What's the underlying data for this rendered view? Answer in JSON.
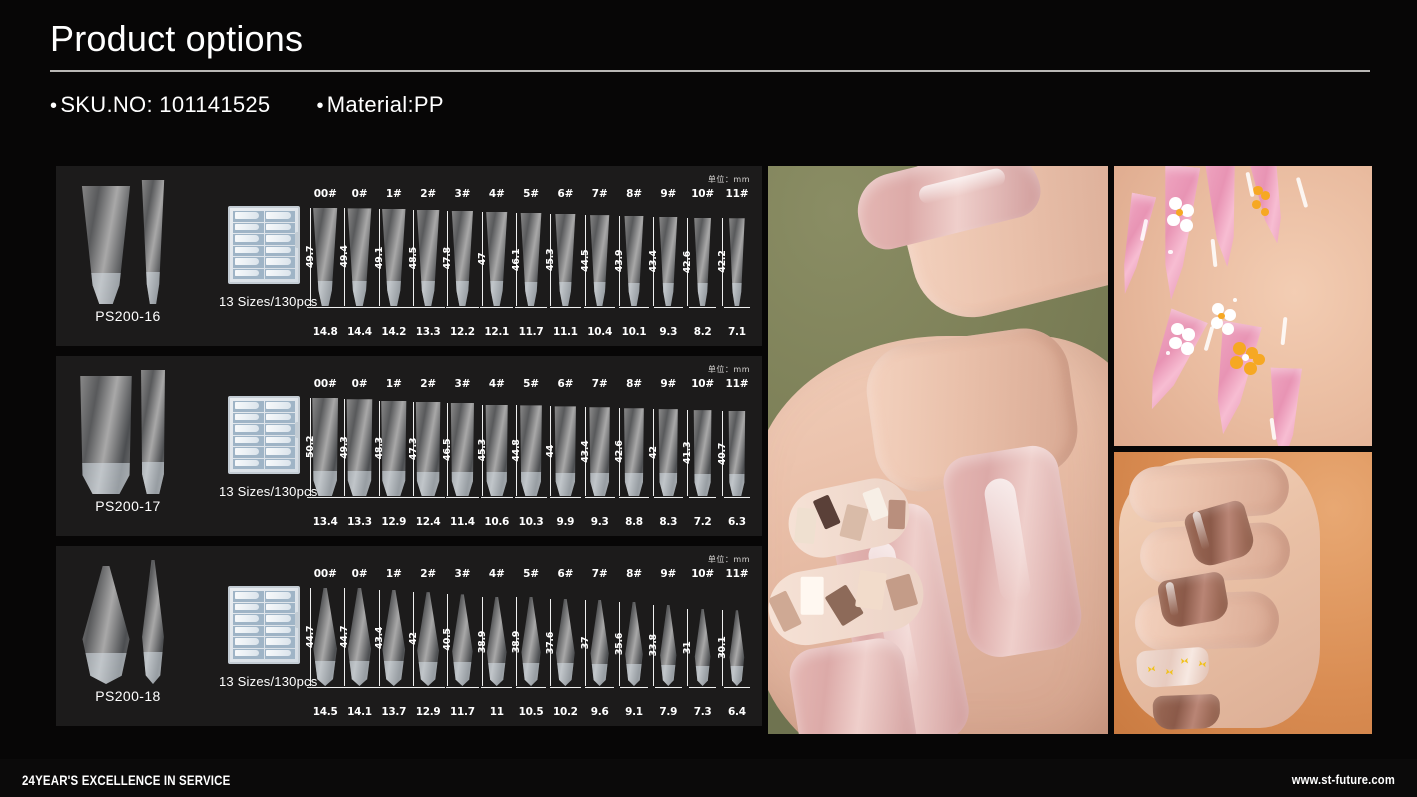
{
  "header": {
    "title": "Product options",
    "specs": [
      {
        "bullet": "•",
        "text": "SKU.NO: 101141525"
      },
      {
        "bullet": "•",
        "text": "Material:PP"
      }
    ]
  },
  "unit_note": "单位：mm",
  "size_labels": [
    "00#",
    "0#",
    "1#",
    "2#",
    "3#",
    "4#",
    "5#",
    "6#",
    "7#",
    "8#",
    "9#",
    "10#",
    "11#"
  ],
  "panels": [
    {
      "code": "PS200-16",
      "pcs": "13 Sizes/130pcs",
      "shape": "coffin",
      "unit": "单位：mm",
      "lengths": [
        49.7,
        49.4,
        49.1,
        48.5,
        47.8,
        47,
        46.1,
        45.3,
        44.5,
        43.9,
        43.4,
        42.6,
        42.2
      ],
      "widths": [
        14.8,
        14.4,
        14.2,
        13.3,
        12.2,
        12.1,
        11.7,
        11.1,
        10.4,
        10.1,
        9.3,
        8.2,
        7.1
      ]
    },
    {
      "code": "PS200-17",
      "pcs": "13 Sizes/130pcs",
      "shape": "square",
      "unit": "单位：mm",
      "lengths": [
        50.2,
        49.3,
        48.3,
        47.3,
        46.5,
        45.3,
        44.8,
        44,
        43.4,
        42.6,
        42,
        41.3,
        40.7
      ],
      "widths": [
        13.4,
        13.3,
        12.9,
        12.4,
        11.4,
        10.6,
        10.3,
        9.9,
        9.3,
        8.8,
        8.3,
        7.2,
        6.3
      ]
    },
    {
      "code": "PS200-18",
      "pcs": "13 Sizes/130pcs",
      "shape": "stiletto",
      "unit": "单位：mm",
      "lengths": [
        44.7,
        44.7,
        43.4,
        42,
        40.5,
        38.9,
        38.9,
        37.6,
        37,
        35.6,
        33.8,
        31,
        30.1
      ],
      "widths": [
        14.5,
        14.1,
        13.7,
        12.9,
        11.7,
        11,
        10.5,
        10.2,
        9.6,
        9.1,
        7.9,
        7.3,
        6.4
      ]
    }
  ],
  "photos": [
    {
      "name": "main-photo",
      "description": "long pink coffin nails with glitter accent on olive background",
      "bg": "#7d8059"
    },
    {
      "name": "top-right-photo",
      "description": "pink stiletto nails with white and orange daisy flower art",
      "bg": "#e8b49b"
    },
    {
      "name": "bottom-right-photo",
      "description": "mocha brown coffin nails with gold butterfly accent nail",
      "bg": "#d4834a"
    }
  ],
  "footer": {
    "left": "24YEAR'S EXCELLENCE IN SERVICE",
    "right": "www.st-future.com"
  },
  "colors": {
    "page_bg": "#070606",
    "panel_bg": "#1c1b1b",
    "text": "#ffffff",
    "rule": "#b9b7b4"
  }
}
